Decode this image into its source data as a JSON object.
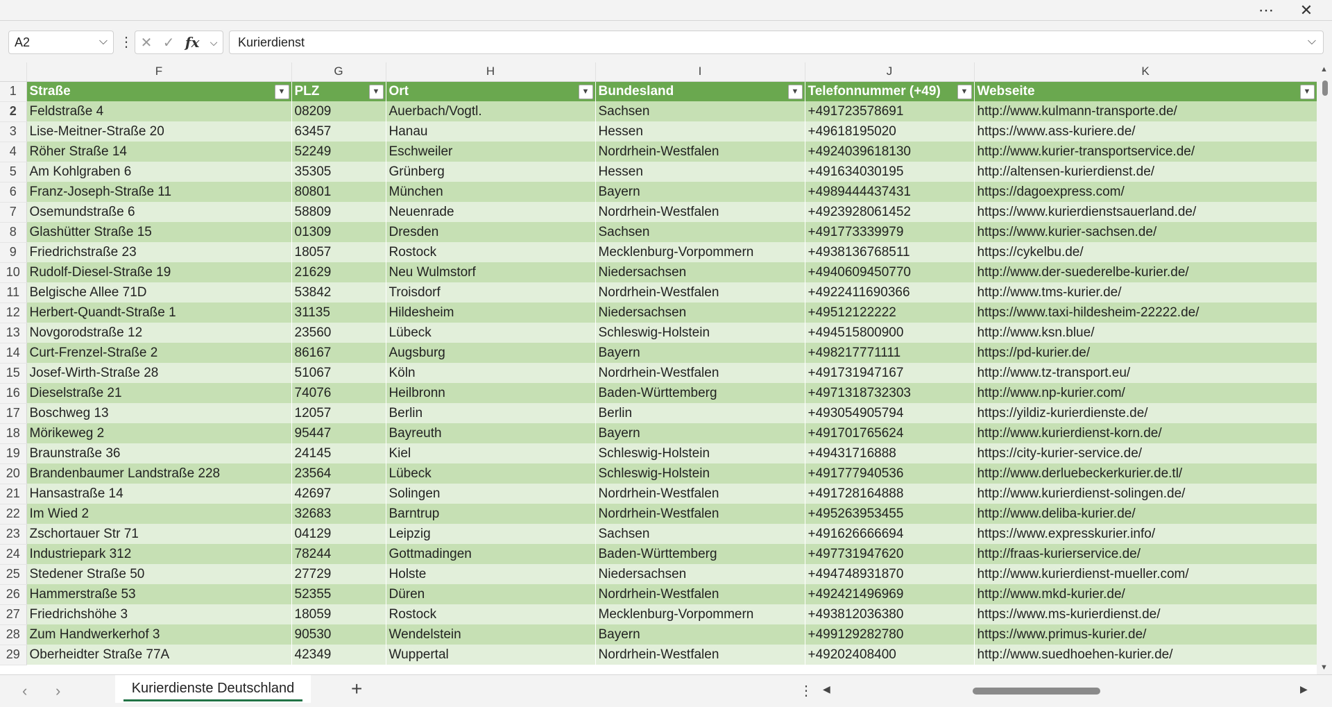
{
  "titlebar": {
    "more_icon": "ellipsis-icon",
    "close_icon": "close-icon"
  },
  "formula_bar": {
    "name_box": "A2",
    "formula": "Kurierdienst"
  },
  "columns": [
    "F",
    "G",
    "H",
    "I",
    "J",
    "K"
  ],
  "header_row": {
    "number": "1",
    "cells": [
      "Straße",
      "PLZ",
      "Ort",
      "Bundesland",
      "Telefonnummer (+49)",
      "Webseite"
    ]
  },
  "rows": [
    {
      "n": "2",
      "c": [
        "Feldstraße 4",
        "08209",
        "Auerbach/Vogtl.",
        "Sachsen",
        "+491723578691",
        "http://www.kulmann-transporte.de/"
      ]
    },
    {
      "n": "3",
      "c": [
        "Lise-Meitner-Straße 20",
        "63457",
        "Hanau",
        "Hessen",
        "+49618195020",
        "https://www.ass-kuriere.de/"
      ]
    },
    {
      "n": "4",
      "c": [
        "Röher Straße 14",
        "52249",
        "Eschweiler",
        "Nordrhein-Westfalen",
        "+4924039618130",
        "http://www.kurier-transportservice.de/"
      ]
    },
    {
      "n": "5",
      "c": [
        "Am Kohlgraben 6",
        "35305",
        "Grünberg",
        "Hessen",
        "+491634030195",
        "http://altensen-kurierdienst.de/"
      ]
    },
    {
      "n": "6",
      "c": [
        "Franz-Joseph-Straße 11",
        "80801",
        "München",
        "Bayern",
        "+4989444437431",
        "https://dagoexpress.com/"
      ]
    },
    {
      "n": "7",
      "c": [
        "Osemundstraße 6",
        "58809",
        "Neuenrade",
        "Nordrhein-Westfalen",
        "+4923928061452",
        "https://www.kurierdienstsauerland.de/"
      ]
    },
    {
      "n": "8",
      "c": [
        "Glashütter Straße 15",
        "01309",
        "Dresden",
        "Sachsen",
        "+491773339979",
        "https://www.kurier-sachsen.de/"
      ]
    },
    {
      "n": "9",
      "c": [
        "Friedrichstraße 23",
        "18057",
        "Rostock",
        "Mecklenburg-Vorpommern",
        "+4938136768511",
        "https://cykelbu.de/"
      ]
    },
    {
      "n": "10",
      "c": [
        "Rudolf-Diesel-Straße 19",
        "21629",
        "Neu Wulmstorf",
        "Niedersachsen",
        "+4940609450770",
        "http://www.der-suederelbe-kurier.de/"
      ]
    },
    {
      "n": "11",
      "c": [
        "Belgische Allee 71D",
        "53842",
        "Troisdorf",
        "Nordrhein-Westfalen",
        "+4922411690366",
        "http://www.tms-kurier.de/"
      ]
    },
    {
      "n": "12",
      "c": [
        "Herbert-Quandt-Straße 1",
        "31135",
        "Hildesheim",
        "Niedersachsen",
        "+49512122222",
        "https://www.taxi-hildesheim-22222.de/"
      ]
    },
    {
      "n": "13",
      "c": [
        "Novgorodstraße 12",
        "23560",
        "Lübeck",
        "Schleswig-Holstein",
        "+494515800900",
        "http://www.ksn.blue/"
      ]
    },
    {
      "n": "14",
      "c": [
        "Curt-Frenzel-Straße 2",
        "86167",
        "Augsburg",
        "Bayern",
        "+498217771111",
        "https://pd-kurier.de/"
      ]
    },
    {
      "n": "15",
      "c": [
        "Josef-Wirth-Straße 28",
        "51067",
        "Köln",
        "Nordrhein-Westfalen",
        "+491731947167",
        "http://www.tz-transport.eu/"
      ]
    },
    {
      "n": "16",
      "c": [
        "Dieselstraße 21",
        "74076",
        "Heilbronn",
        "Baden-Württemberg",
        "+4971318732303",
        "http://www.np-kurier.com/"
      ]
    },
    {
      "n": "17",
      "c": [
        "Boschweg 13",
        "12057",
        "Berlin",
        "Berlin",
        "+493054905794",
        "https://yildiz-kurierdienste.de/"
      ]
    },
    {
      "n": "18",
      "c": [
        "Mörikeweg 2",
        "95447",
        "Bayreuth",
        "Bayern",
        "+491701765624",
        "http://www.kurierdienst-korn.de/"
      ]
    },
    {
      "n": "19",
      "c": [
        "Braunstraße 36",
        "24145",
        "Kiel",
        "Schleswig-Holstein",
        "+49431716888",
        "https://city-kurier-service.de/"
      ]
    },
    {
      "n": "20",
      "c": [
        "Brandenbaumer Landstraße 228",
        "23564",
        "Lübeck",
        "Schleswig-Holstein",
        "+491777940536",
        "http://www.derluebeckerkurier.de.tl/"
      ]
    },
    {
      "n": "21",
      "c": [
        "Hansastraße 14",
        "42697",
        "Solingen",
        "Nordrhein-Westfalen",
        "+491728164888",
        "http://www.kurierdienst-solingen.de/"
      ]
    },
    {
      "n": "22",
      "c": [
        "Im Wied 2",
        "32683",
        "Barntrup",
        "Nordrhein-Westfalen",
        "+495263953455",
        "http://www.deliba-kurier.de/"
      ]
    },
    {
      "n": "23",
      "c": [
        "Zschortauer Str 71",
        "04129",
        "Leipzig",
        "Sachsen",
        "+491626666694",
        "https://www.expresskurier.info/"
      ]
    },
    {
      "n": "24",
      "c": [
        "Industriepark 312",
        "78244",
        "Gottmadingen",
        "Baden-Württemberg",
        "+497731947620",
        "http://fraas-kurierservice.de/"
      ]
    },
    {
      "n": "25",
      "c": [
        "Stedener Straße 50",
        "27729",
        "Holste",
        "Niedersachsen",
        "+494748931870",
        "http://www.kurierdienst-mueller.com/"
      ]
    },
    {
      "n": "26",
      "c": [
        "Hammerstraße 53",
        "52355",
        "Düren",
        "Nordrhein-Westfalen",
        "+492421496969",
        "http://www.mkd-kurier.de/"
      ]
    },
    {
      "n": "27",
      "c": [
        "Friedrichshöhe 3",
        "18059",
        "Rostock",
        "Mecklenburg-Vorpommern",
        "+493812036380",
        "https://www.ms-kurierdienst.de/"
      ]
    },
    {
      "n": "28",
      "c": [
        "Zum Handwerkerhof 3",
        "90530",
        "Wendelstein",
        "Bayern",
        "+499129282780",
        "https://www.primus-kurier.de/"
      ]
    },
    {
      "n": "29",
      "c": [
        "Oberheidter Straße 77A",
        "42349",
        "Wuppertal",
        "Nordrhein-Westfalen",
        "+49202408400",
        "http://www.suedhoehen-kurier.de/"
      ]
    }
  ],
  "sheet_tabs": [
    {
      "label": "Kurierdienste Deutschland",
      "active": true
    }
  ],
  "colors": {
    "header_green": "#6aa84f",
    "band_dark": "#c6e0b4",
    "band_light": "#e2efda",
    "accent": "#217346"
  }
}
